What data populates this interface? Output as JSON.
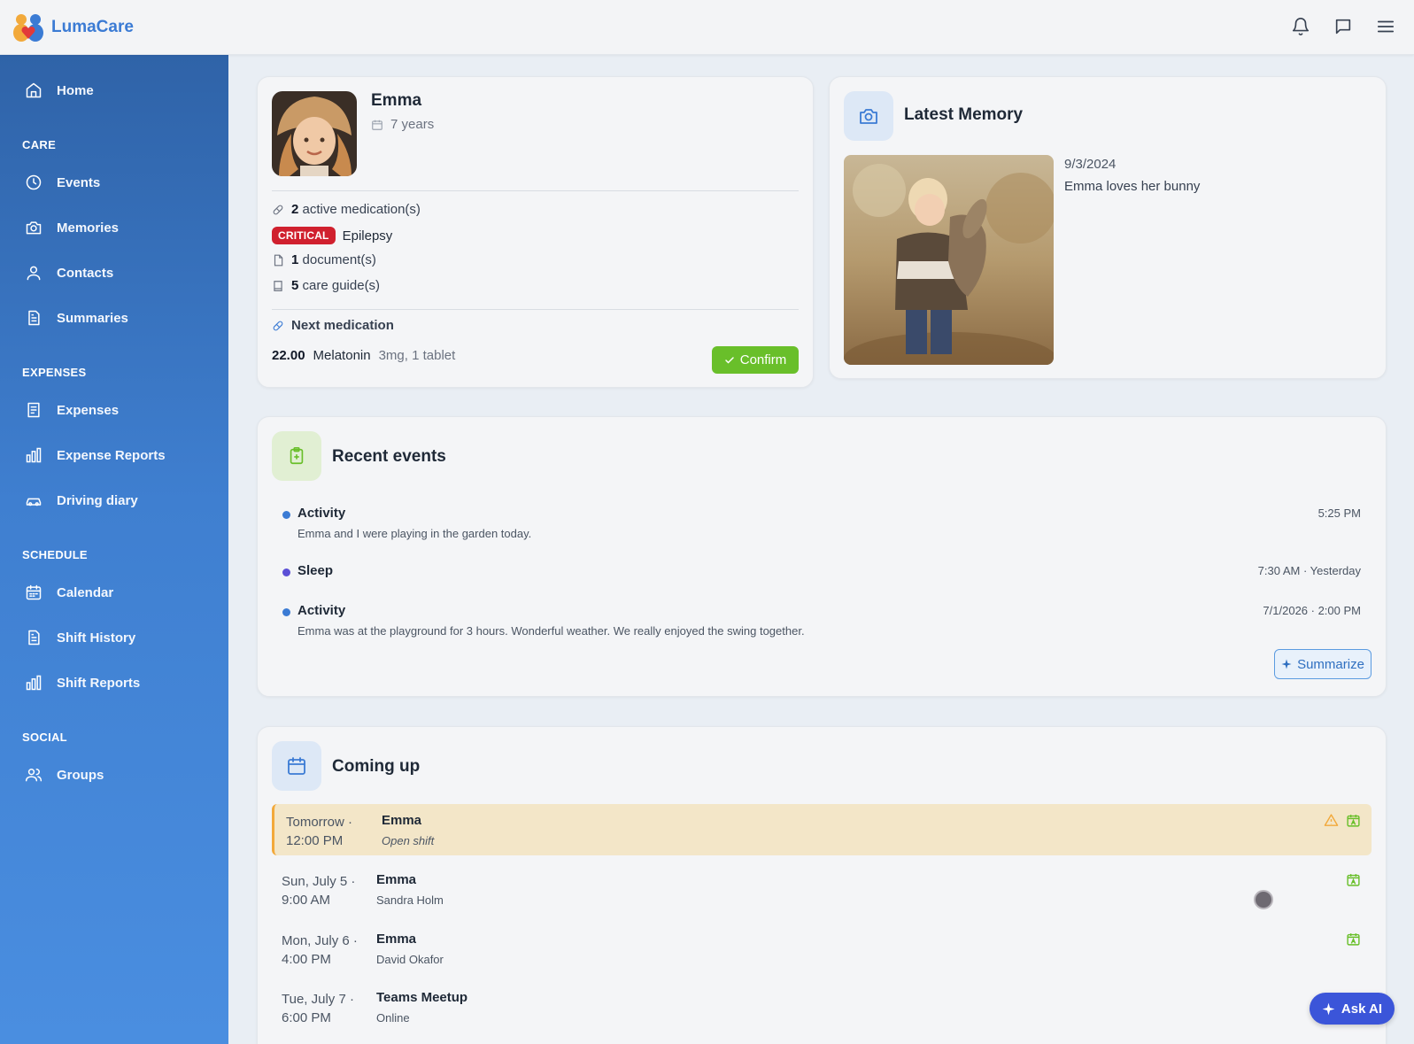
{
  "app": {
    "brand": "LumaCare"
  },
  "sidebar": {
    "home": "Home",
    "sections": {
      "care": "CARE",
      "expenses": "EXPENSES",
      "schedule": "SCHEDULE",
      "social": "SOCIAL"
    },
    "items": {
      "events": "Events",
      "memories": "Memories",
      "contacts": "Contacts",
      "summaries": "Summaries",
      "expenses": "Expenses",
      "expense_reports": "Expense Reports",
      "driving_diary": "Driving diary",
      "calendar": "Calendar",
      "shift_history": "Shift History",
      "shift_reports": "Shift Reports",
      "groups": "Groups"
    }
  },
  "profile": {
    "name": "Emma",
    "age": "7 years",
    "medications_count": "2",
    "medications_label": "active medication(s)",
    "condition_badge": "CRITICAL",
    "condition": "Epilepsy",
    "documents_count": "1",
    "documents_label": "document(s)",
    "guides_count": "5",
    "guides_label": "care guide(s)",
    "next_med_label": "Next medication",
    "next_med_time": "22.00",
    "next_med_name": "Melatonin",
    "next_med_dose": "3mg, 1 tablet",
    "confirm_label": "Confirm"
  },
  "memory": {
    "title": "Latest Memory",
    "date": "9/3/2024",
    "caption": "Emma loves her bunny"
  },
  "events": {
    "title": "Recent events",
    "items": [
      {
        "type": "Activity",
        "description": "Emma and I were playing in the garden today.",
        "time": "5:25 PM",
        "color": "#3b7bd4"
      },
      {
        "type": "Sleep",
        "description": "",
        "time": "7:30 AM · Yesterday",
        "color": "#5b4fd6"
      },
      {
        "type": "Activity",
        "description": "Emma was at the playground for 3 hours. Wonderful weather. We really enjoyed the swing together.",
        "time": "7/1/2026 · 2:00 PM",
        "color": "#3b7bd4"
      }
    ],
    "summarize_label": "Summarize"
  },
  "upcoming": {
    "title": "Coming up",
    "items": [
      {
        "day": "Tomorrow ·",
        "time": "12:00 PM",
        "who": "Emma",
        "sub": "Open shift"
      },
      {
        "day": "Sun, July 5 ·",
        "time": "9:00 AM",
        "who": "Emma",
        "sub": "Sandra Holm"
      },
      {
        "day": "Mon, July 6 ·",
        "time": "4:00 PM",
        "who": "Emma",
        "sub": "David Okafor"
      },
      {
        "day": "Tue, July 7 ·",
        "time": "6:00 PM",
        "who": "Teams Meetup",
        "sub": "Online"
      }
    ]
  },
  "ask_ai": "Ask AI",
  "colors": {
    "accent": "#3b7bd4",
    "confirm": "#69bf2a",
    "critical": "#d0202e",
    "warning": "#f2a93b"
  }
}
